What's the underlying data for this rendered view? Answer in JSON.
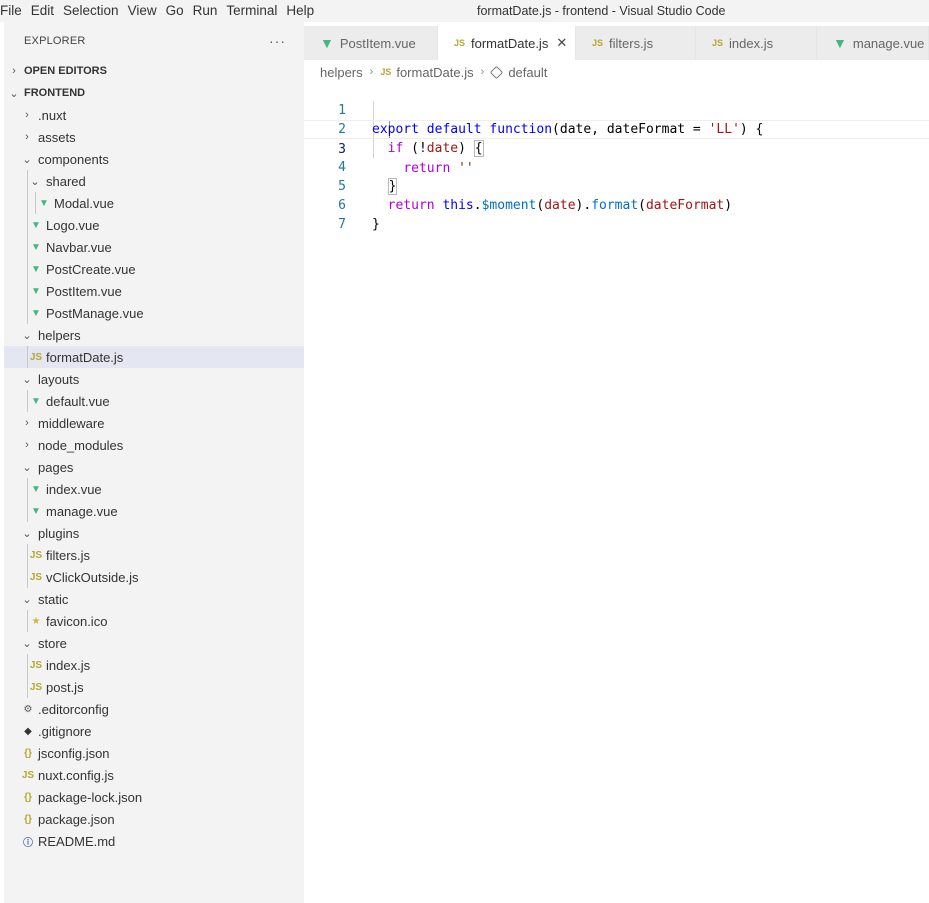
{
  "menu": [
    "File",
    "Edit",
    "Selection",
    "View",
    "Go",
    "Run",
    "Terminal",
    "Help"
  ],
  "window_title": "formatDate.js - frontend - Visual Studio Code",
  "explorer": {
    "title": "EXPLORER",
    "more": "···",
    "open_editors": "OPEN EDITORS",
    "project": "FRONTEND",
    "items": [
      {
        "label": ".nuxt",
        "type": "folder",
        "expanded": false,
        "depth": 0
      },
      {
        "label": "assets",
        "type": "folder",
        "expanded": false,
        "depth": 0
      },
      {
        "label": "components",
        "type": "folder",
        "expanded": true,
        "depth": 0
      },
      {
        "label": "shared",
        "type": "folder",
        "expanded": true,
        "depth": 1
      },
      {
        "label": "Modal.vue",
        "type": "vue",
        "depth": 2
      },
      {
        "label": "Logo.vue",
        "type": "vue",
        "depth": 1
      },
      {
        "label": "Navbar.vue",
        "type": "vue",
        "depth": 1
      },
      {
        "label": "PostCreate.vue",
        "type": "vue",
        "depth": 1
      },
      {
        "label": "PostItem.vue",
        "type": "vue",
        "depth": 1
      },
      {
        "label": "PostManage.vue",
        "type": "vue",
        "depth": 1
      },
      {
        "label": "helpers",
        "type": "folder",
        "expanded": true,
        "depth": 0
      },
      {
        "label": "formatDate.js",
        "type": "js",
        "depth": 1,
        "selected": true
      },
      {
        "label": "layouts",
        "type": "folder",
        "expanded": true,
        "depth": 0
      },
      {
        "label": "default.vue",
        "type": "vue",
        "depth": 1
      },
      {
        "label": "middleware",
        "type": "folder",
        "expanded": false,
        "depth": 0
      },
      {
        "label": "node_modules",
        "type": "folder",
        "expanded": false,
        "depth": 0
      },
      {
        "label": "pages",
        "type": "folder",
        "expanded": true,
        "depth": 0
      },
      {
        "label": "index.vue",
        "type": "vue",
        "depth": 1
      },
      {
        "label": "manage.vue",
        "type": "vue",
        "depth": 1
      },
      {
        "label": "plugins",
        "type": "folder",
        "expanded": true,
        "depth": 0
      },
      {
        "label": "filters.js",
        "type": "js",
        "depth": 1
      },
      {
        "label": "vClickOutside.js",
        "type": "js",
        "depth": 1
      },
      {
        "label": "static",
        "type": "folder",
        "expanded": true,
        "depth": 0
      },
      {
        "label": "favicon.ico",
        "type": "star",
        "depth": 1
      },
      {
        "label": "store",
        "type": "folder",
        "expanded": true,
        "depth": 0
      },
      {
        "label": "index.js",
        "type": "js",
        "depth": 1
      },
      {
        "label": "post.js",
        "type": "js",
        "depth": 1
      },
      {
        "label": ".editorconfig",
        "type": "gear",
        "depth": 0
      },
      {
        "label": ".gitignore",
        "type": "diamond",
        "depth": 0
      },
      {
        "label": "jsconfig.json",
        "type": "json",
        "depth": 0
      },
      {
        "label": "nuxt.config.js",
        "type": "js",
        "depth": 0
      },
      {
        "label": "package-lock.json",
        "type": "json",
        "depth": 0
      },
      {
        "label": "package.json",
        "type": "json",
        "depth": 0
      },
      {
        "label": "README.md",
        "type": "info",
        "depth": 0
      }
    ]
  },
  "tabs": [
    {
      "label": "PostItem.vue",
      "type": "vue",
      "active": false
    },
    {
      "label": "formatDate.js",
      "type": "js",
      "active": true
    },
    {
      "label": "filters.js",
      "type": "js",
      "active": false
    },
    {
      "label": "index.js",
      "type": "js",
      "active": false
    },
    {
      "label": "manage.vue",
      "type": "vue",
      "active": false
    }
  ],
  "icons": {
    "js": "JS",
    "vue": "▼",
    "json": "{}",
    "star": "★",
    "gear": "⚙",
    "diamond": "◆",
    "info": "ⓘ",
    "chevron_right": "›",
    "chevron_down": "⌄",
    "close": "✕"
  },
  "breadcrumb": {
    "folder": "helpers",
    "file": "formatDate.js",
    "symbol": "default"
  },
  "editor": {
    "current_line": 3,
    "line_numbers": [
      "1",
      "2",
      "3",
      "4",
      "5",
      "6",
      "7"
    ],
    "tokens": {
      "export": "export",
      "default": "default",
      "function": "function",
      "params_open": "(date, dateFormat = ",
      "ll": "'LL'",
      "params_close": ") {",
      "if": "if",
      "cond_open": " (!",
      "date": "date",
      "cond_close": ") ",
      "brace_open": "{",
      "return": "return",
      "empty_str": "''",
      "brace_close": "}",
      "this": "this",
      "dot": ".",
      "moment": "$moment",
      "format": "format",
      "dateFormat": "dateFormat",
      "fn_close": "}"
    }
  },
  "colors": {
    "sidebar_bg": "#f3f3f3",
    "selection_bg": "#e4e6f1",
    "vue_green": "#41b883",
    "js_yellow": "#b5a82c",
    "keyword_blue": "#0000ff",
    "control_purple": "#af00db",
    "string_red": "#a31515",
    "line_number": "#237893"
  }
}
